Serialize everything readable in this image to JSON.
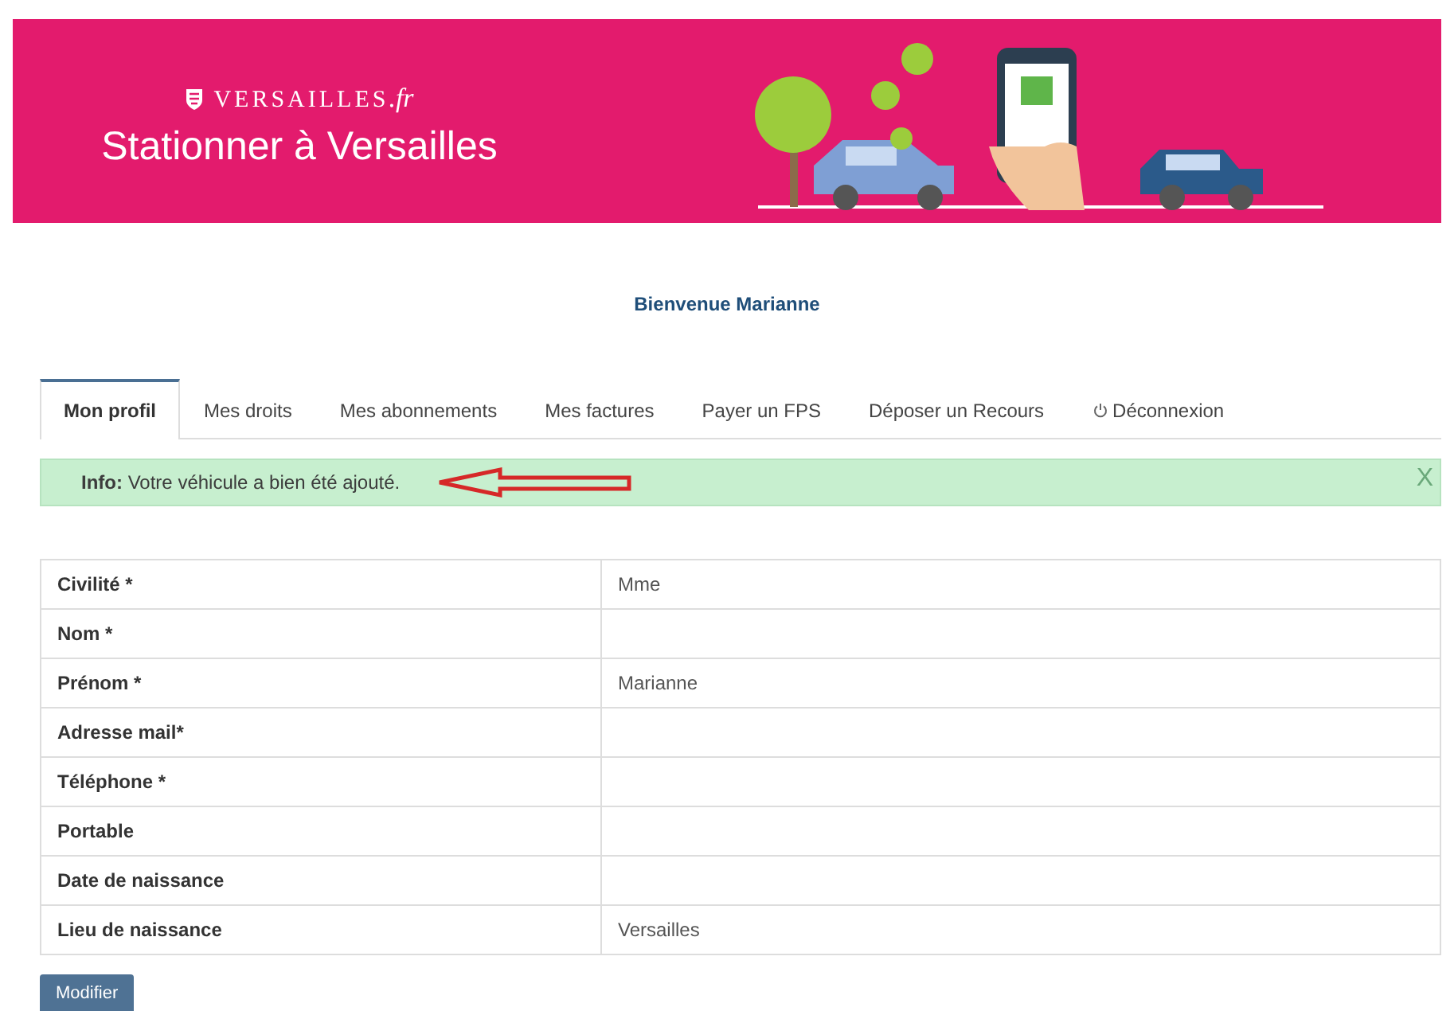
{
  "header": {
    "logo": "VERSAILLES",
    "logo_suffix": ".fr",
    "title": "Stationner à Versailles"
  },
  "welcome": "Bienvenue Marianne",
  "tabs": [
    {
      "label": "Mon profil",
      "selected": true,
      "kind": "tab"
    },
    {
      "label": "Mes droits",
      "selected": false,
      "kind": "tab"
    },
    {
      "label": "Mes abonnements",
      "selected": false,
      "kind": "tab"
    },
    {
      "label": "Mes factures",
      "selected": false,
      "kind": "tab"
    },
    {
      "label": "Payer un FPS",
      "selected": false,
      "kind": "tab"
    },
    {
      "label": "Déposer un Recours",
      "selected": false,
      "kind": "tab"
    },
    {
      "label": "Déconnexion",
      "selected": false,
      "kind": "logout"
    }
  ],
  "alert": {
    "message": "**Info:** Votre véhicule a bien été ajouté.",
    "close": "X"
  },
  "profile_rows": [
    {
      "label": "Civilité *",
      "value": "Mme"
    },
    {
      "label": "Nom *",
      "value": ""
    },
    {
      "label": "Prénom *",
      "value": "Marianne"
    },
    {
      "label": "Adresse mail*",
      "value": ""
    },
    {
      "label": "Téléphone *",
      "value": ""
    },
    {
      "label": "Portable",
      "value": ""
    },
    {
      "label": "Date de naissance",
      "value": ""
    },
    {
      "label": "Lieu de naissance",
      "value": "Versailles"
    }
  ],
  "buttons": [
    "Modifier"
  ]
}
